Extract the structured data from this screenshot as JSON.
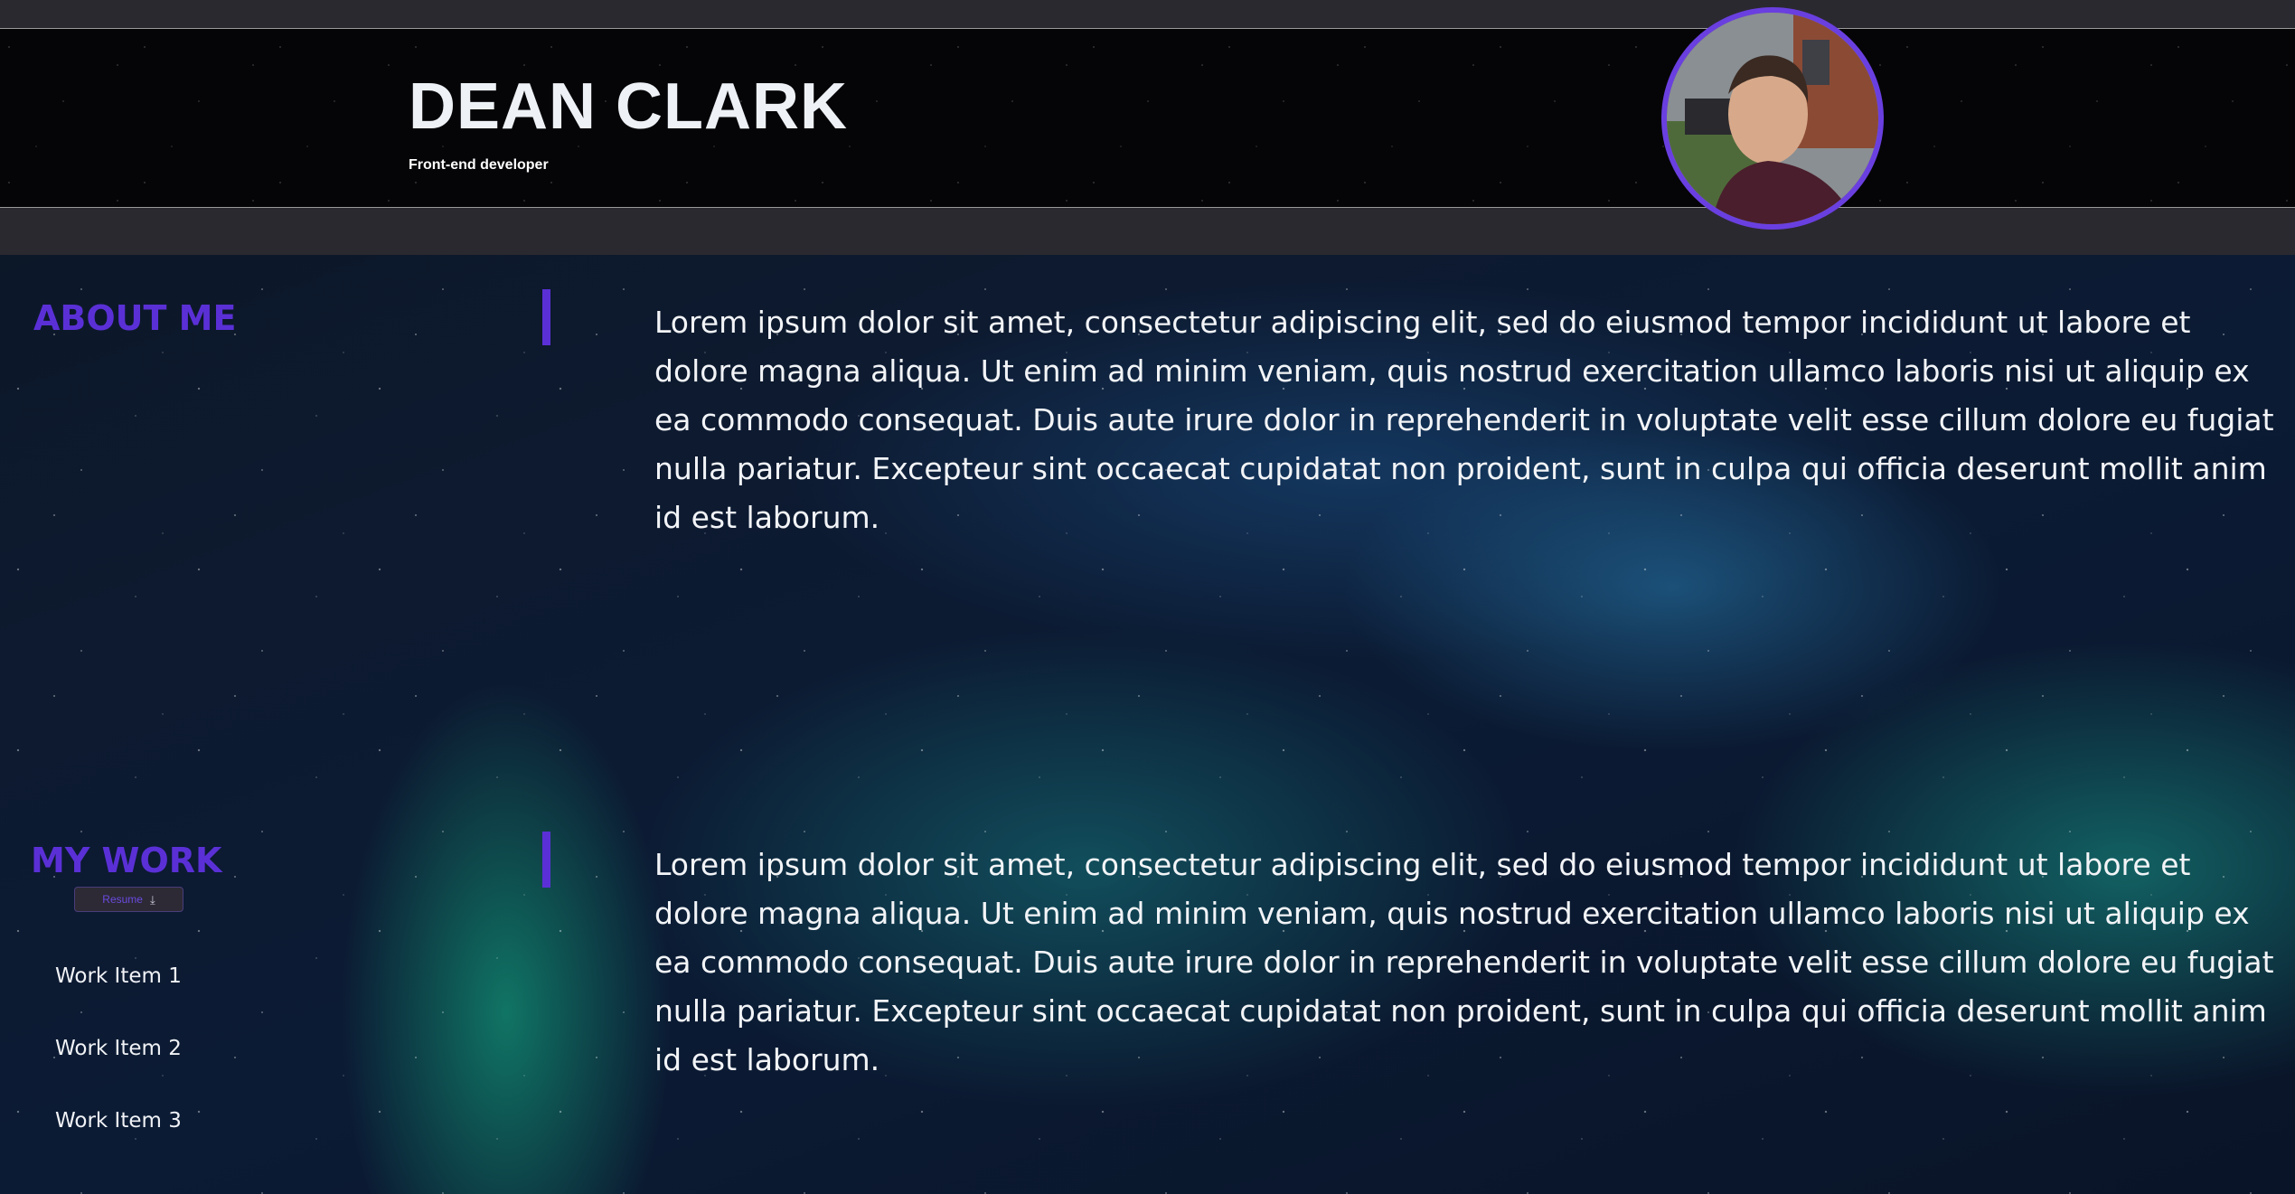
{
  "header": {
    "name": "DEAN CLARK",
    "role": "Front-end developer",
    "avatar_icon": "profile-photo"
  },
  "about": {
    "heading": "ABOUT ME",
    "text": "Lorem ipsum dolor sit amet, consectetur adipiscing elit, sed do eiusmod tempor incididunt ut labore et dolore magna aliqua. Ut enim ad minim veniam, quis nostrud exercitation ullamco laboris nisi ut aliquip ex ea commodo consequat. Duis aute irure dolor in reprehenderit in voluptate velit esse cillum dolore eu fugiat nulla pariatur. Excepteur sint occaecat cupidatat non proident, sunt in culpa qui officia deserunt mollit anim id est laborum."
  },
  "work": {
    "heading": "MY WORK",
    "resume_label": "Resume",
    "resume_icon": "download-icon",
    "items": [
      {
        "label": "Work Item 1"
      },
      {
        "label": "Work Item 2"
      },
      {
        "label": "Work Item 3"
      }
    ],
    "text": "Lorem ipsum dolor sit amet, consectetur adipiscing elit, sed do eiusmod tempor incididunt ut labore et dolore magna aliqua. Ut enim ad minim veniam, quis nostrud exercitation ullamco laboris nisi ut aliquip ex ea commodo consequat. Duis aute irure dolor in reprehenderit in voluptate velit esse cillum dolore eu fugiat nulla pariatur. Excepteur sint occaecat cupidatat non proident, sunt in culpa qui officia deserunt mollit anim id est laborum."
  },
  "colors": {
    "accent": "#5a30d6",
    "header_strip": "#2b2930",
    "text": "#f2f4f7"
  }
}
